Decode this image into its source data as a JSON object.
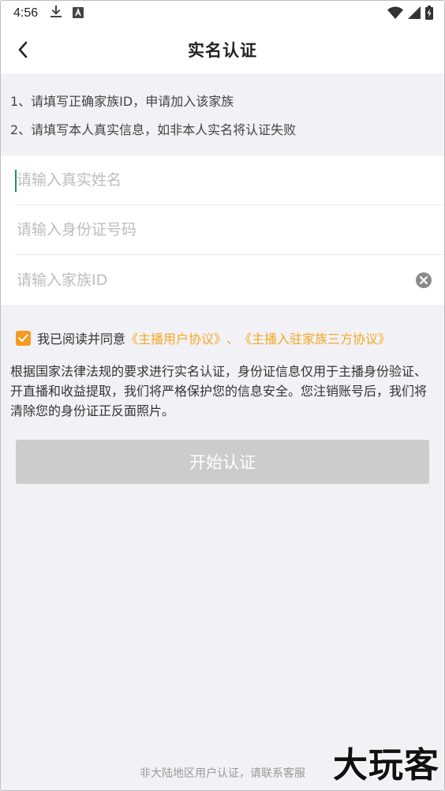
{
  "status_bar": {
    "time": "4:56",
    "left_icons": [
      "download-icon",
      "font-a-icon"
    ],
    "right_icons": [
      "wifi-icon",
      "cellular-signal-icon",
      "battery-charging-icon"
    ]
  },
  "nav": {
    "back_icon": "chevron-left-icon",
    "title": "实名认证"
  },
  "notices": [
    "1、请填写正确家族ID，申请加入该家族",
    "2、请填写本人真实信息，如非本人实名将认证失败"
  ],
  "form": {
    "name_placeholder": "请输入真实姓名",
    "name_value": "",
    "id_card_placeholder": "请输入身份证号码",
    "id_card_value": "",
    "family_id_placeholder": "请输入家族ID",
    "family_id_value": "",
    "clear_icon": "clear-circle-icon"
  },
  "agreement": {
    "checked": true,
    "prefix": "我已阅读并同意",
    "link1": "《主播用户协议》",
    "separator": "、",
    "link2": "《主播入驻家族三方协议》"
  },
  "description": "根据国家法律法规的要求进行实名认证，身份证信息仅用于主播身份验证、开直播和收益提取，我们将严格保护您的信息安全。您注销账号后，我们将清除您的身份证正反面照片。",
  "submit": {
    "label": "开始认证"
  },
  "footer": {
    "text": "非大陆地区用户认证，请联系客服"
  },
  "watermark": "大玩客",
  "colors": {
    "accent": "#f5a623",
    "checkbox": "#f59a23",
    "button_disabled": "#cccccc",
    "page_bg": "#f2f2f6",
    "caret": "#1a8f7a"
  }
}
